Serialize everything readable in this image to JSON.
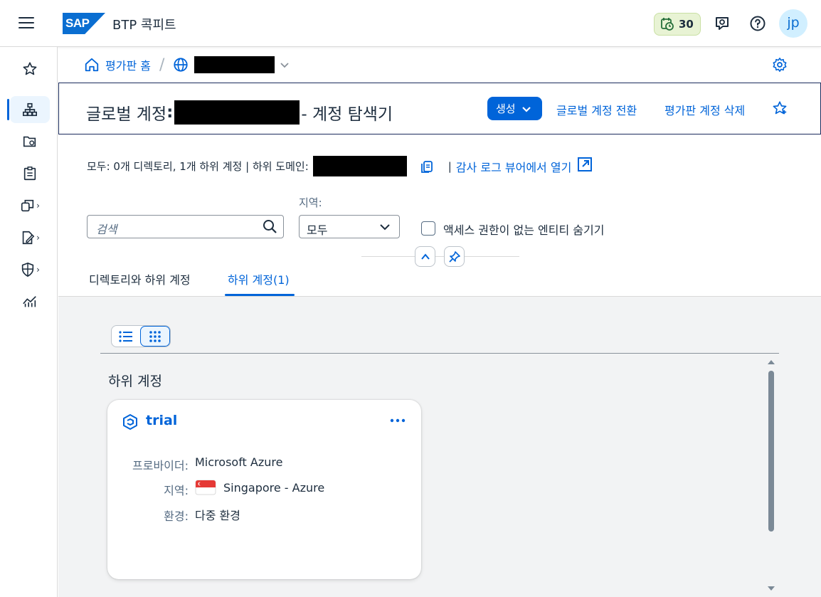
{
  "shell": {
    "product_title": "BTP 콕피트",
    "logo_text": "SAP",
    "trial_days": "30",
    "avatar_initials": "jp"
  },
  "breadcrumb": {
    "home_label": "평가판 홈"
  },
  "header": {
    "title_prefix": "글로벌 계정",
    "title_colon": ":",
    "title_suffix": "- 계정 탐색기",
    "create_label": "생성",
    "switch_label": "글로벌 계정 전환",
    "delete_label": "평가판 계정 삭제"
  },
  "info": {
    "summary": "모두: 0개 디렉토리, 1개 하위 계정 | 하위 도메인:",
    "separator": "|",
    "audit_link": "감사 로그 뷰어에서 열기"
  },
  "filters": {
    "search_placeholder": "검색",
    "region_label": "지역:",
    "region_value": "모두",
    "hide_label": "액세스 권한이 없는 엔티티 숨기기",
    "hide_checked": false
  },
  "tabs": [
    {
      "label": "디렉토리와 하위 계정",
      "active": false
    },
    {
      "label": "하위 계정(1)",
      "active": true
    }
  ],
  "content": {
    "view_mode": "tiles",
    "section_title": "하위 계정",
    "cards": [
      {
        "name": "trial",
        "provider_key": "프로바이더:",
        "provider_val": "Microsoft Azure",
        "region_key": "지역:",
        "region_val": "Singapore - Azure",
        "env_key": "환경:",
        "env_val": "다중 환경"
      }
    ]
  },
  "colors": {
    "accent": "#0064d9",
    "trial_badge_bg": "#e8f3d4",
    "content_bg": "#f2f3f4"
  }
}
